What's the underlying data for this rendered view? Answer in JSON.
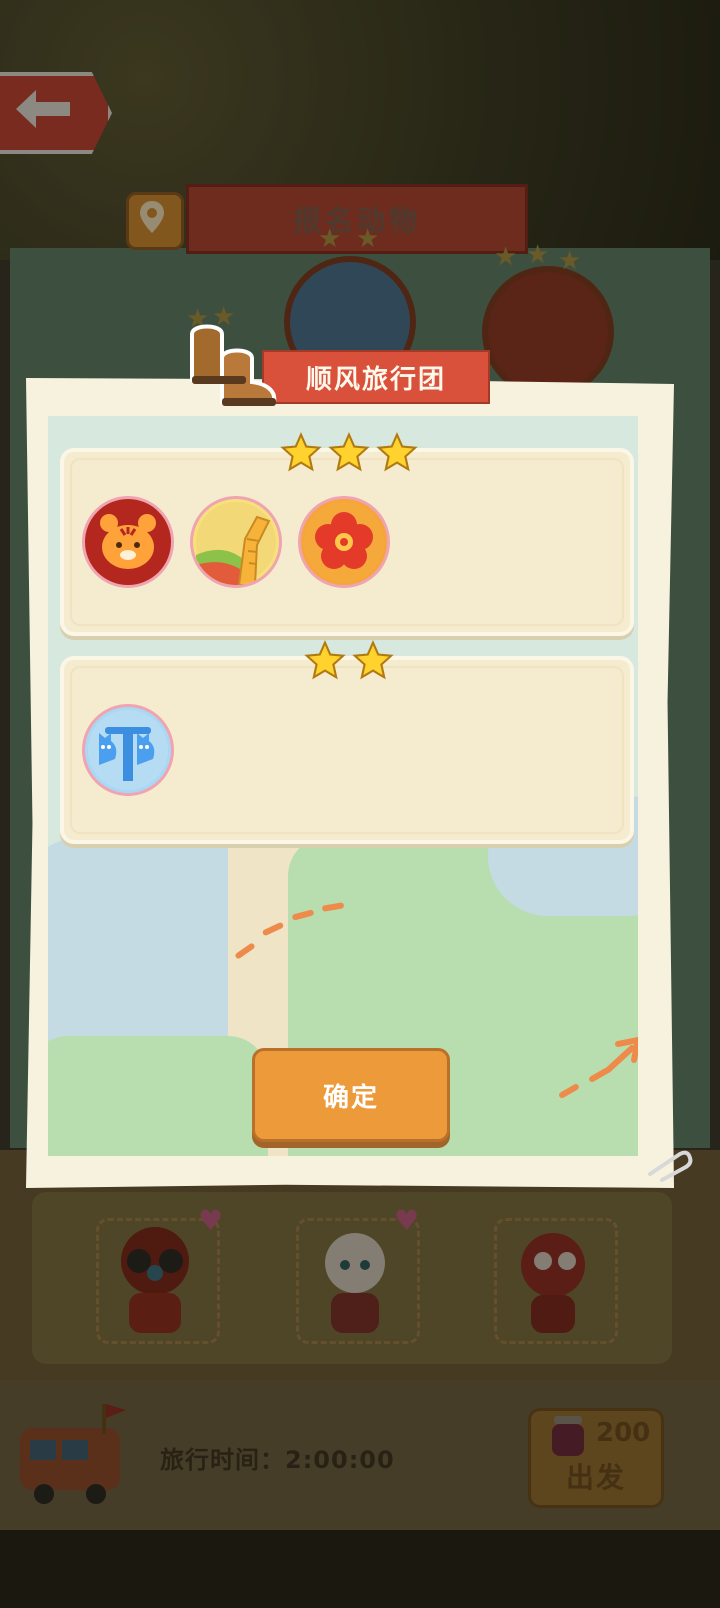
{
  "background": {
    "header_title": "报名动物",
    "footer": {
      "travel_time_label": "旅行时间：",
      "travel_time_value": "2:00:00",
      "go_cost": "200",
      "go_label": "出发"
    }
  },
  "dialog": {
    "title": "顺风旅行团",
    "tiers": [
      {
        "stars": 3,
        "items": [
          {
            "icon": "tiger-face-badge-icon"
          },
          {
            "icon": "great-wall-badge-icon"
          },
          {
            "icon": "plum-blossom-badge-icon"
          }
        ]
      },
      {
        "stars": 2,
        "items": [
          {
            "icon": "twin-cats-tower-badge-icon"
          }
        ]
      }
    ],
    "confirm_label": "确定"
  },
  "colors": {
    "ribbon": "#d9513a",
    "paper": "#f7f2de",
    "confirm": "#ed9a3a",
    "star": "#ffd22e"
  }
}
